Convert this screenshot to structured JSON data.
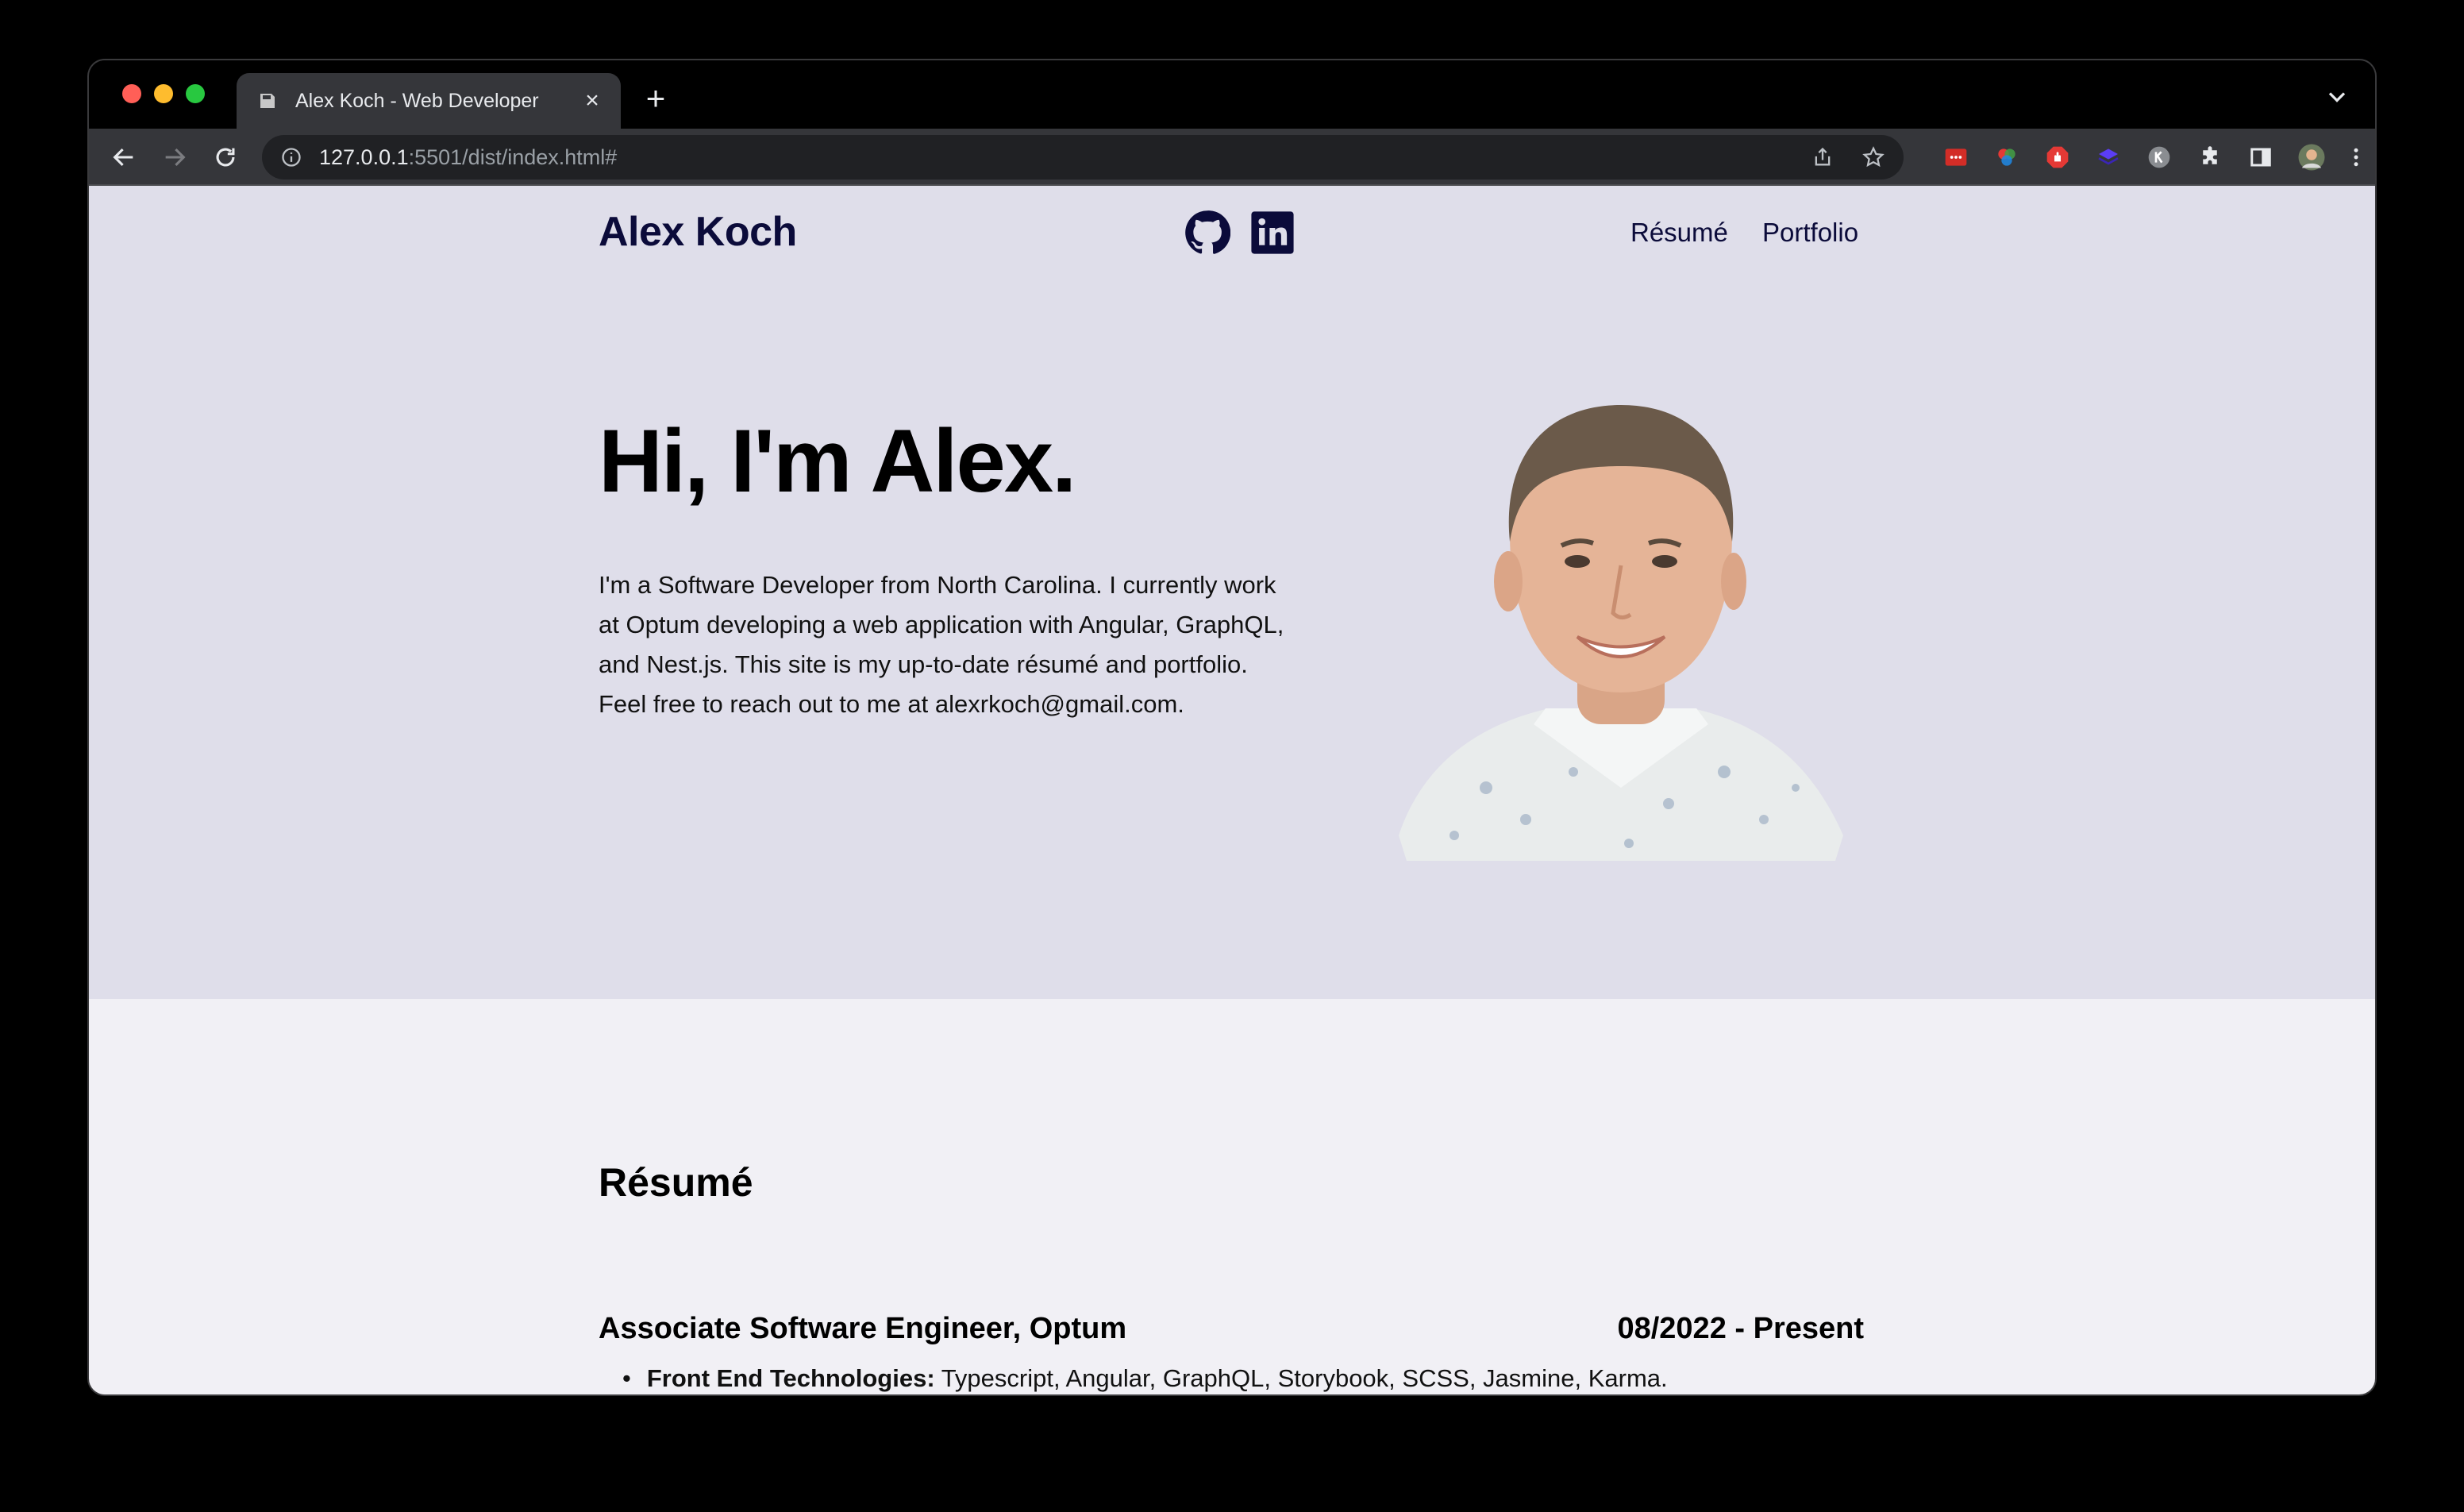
{
  "browser": {
    "tab_title": "Alex Koch - Web Developer",
    "tab_close": "×",
    "new_tab": "+",
    "url_host": "127.0.0.1",
    "url_rest": ":5501/dist/index.html#"
  },
  "header": {
    "site_title": "Alex Koch",
    "nav": [
      "Résumé",
      "Portfolio"
    ]
  },
  "hero": {
    "heading": "Hi, I'm Alex.",
    "intro": "I'm a Software Developer from North Carolina. I currently work at Optum developing a web application with Angular, GraphQL, and Nest.js. This site is my up-to-date résumé and portfolio. Feel free to reach out to me at alexrkoch@gmail.com."
  },
  "resume": {
    "section_title": "Résumé",
    "jobs": [
      {
        "title": "Associate Software Engineer, Optum",
        "dates": "08/2022 - Present",
        "bullets": [
          {
            "label": "Front End Technologies:",
            "text": " Typescript, Angular, GraphQL, Storybook, SCSS, Jasmine, Karma."
          }
        ]
      }
    ]
  },
  "colors": {
    "hero_bg": "#dfdeea",
    "page_bg": "#f1f0f5",
    "navy": "#0b0b3a"
  }
}
